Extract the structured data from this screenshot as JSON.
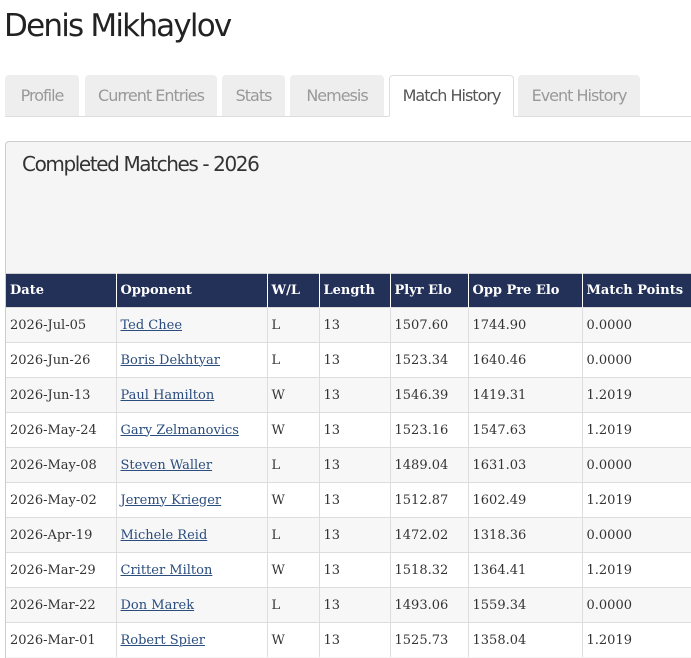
{
  "player": {
    "name": "Denis Mikhaylov"
  },
  "tabs": [
    {
      "label": "Profile",
      "active": false
    },
    {
      "label": "Current Entries",
      "active": false
    },
    {
      "label": "Stats",
      "active": false
    },
    {
      "label": "Nemesis",
      "active": false
    },
    {
      "label": "Match History",
      "active": true
    },
    {
      "label": "Event History",
      "active": false
    }
  ],
  "panel": {
    "title": "Completed Matches - 2026"
  },
  "table": {
    "headers": [
      "Date",
      "Opponent",
      "W/L",
      "Length",
      "Plyr Elo",
      "Opp Pre Elo",
      "Match Points"
    ],
    "rows": [
      {
        "date": "2026-Jul-05",
        "opponent": "Ted Chee",
        "wl": "L",
        "length": "13",
        "plyr_elo": "1507.60",
        "opp_elo": "1744.90",
        "points": "0.0000"
      },
      {
        "date": "2026-Jun-26",
        "opponent": "Boris Dekhtyar",
        "wl": "L",
        "length": "13",
        "plyr_elo": "1523.34",
        "opp_elo": "1640.46",
        "points": "0.0000"
      },
      {
        "date": "2026-Jun-13",
        "opponent": "Paul Hamilton",
        "wl": "W",
        "length": "13",
        "plyr_elo": "1546.39",
        "opp_elo": "1419.31",
        "points": "1.2019"
      },
      {
        "date": "2026-May-24",
        "opponent": "Gary Zelmanovics",
        "wl": "W",
        "length": "13",
        "plyr_elo": "1523.16",
        "opp_elo": "1547.63",
        "points": "1.2019"
      },
      {
        "date": "2026-May-08",
        "opponent": "Steven Waller",
        "wl": "L",
        "length": "13",
        "plyr_elo": "1489.04",
        "opp_elo": "1631.03",
        "points": "0.0000"
      },
      {
        "date": "2026-May-02",
        "opponent": "Jeremy Krieger",
        "wl": "W",
        "length": "13",
        "plyr_elo": "1512.87",
        "opp_elo": "1602.49",
        "points": "1.2019"
      },
      {
        "date": "2026-Apr-19",
        "opponent": "Michele Reid",
        "wl": "L",
        "length": "13",
        "plyr_elo": "1472.02",
        "opp_elo": "1318.36",
        "points": "0.0000"
      },
      {
        "date": "2026-Mar-29",
        "opponent": "Critter Milton",
        "wl": "W",
        "length": "13",
        "plyr_elo": "1518.32",
        "opp_elo": "1364.41",
        "points": "1.2019"
      },
      {
        "date": "2026-Mar-22",
        "opponent": "Don Marek",
        "wl": "L",
        "length": "13",
        "plyr_elo": "1493.06",
        "opp_elo": "1559.34",
        "points": "0.0000"
      },
      {
        "date": "2026-Mar-01",
        "opponent": "Robert Spier",
        "wl": "W",
        "length": "13",
        "plyr_elo": "1525.73",
        "opp_elo": "1358.04",
        "points": "1.2019"
      }
    ]
  }
}
